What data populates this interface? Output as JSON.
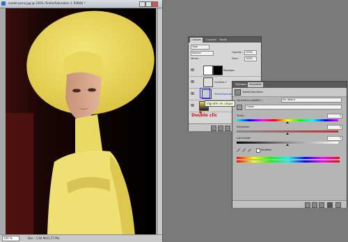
{
  "document": {
    "title": "model-yarno.jpg @ 100% (Teinte/Saturation 1, RVB/8) *",
    "zoom": "100 %",
    "info": "Doc : 1,94 Mo/1,77 Mo"
  },
  "layers_panel": {
    "tabs": [
      "Calques",
      "Couches",
      "Tracés"
    ],
    "kind_filter": "Type",
    "blend_mode": "Normal",
    "opacity_label": "Opacité :",
    "opacity_value": "100%",
    "lock_label": "Verrou :",
    "fill_label": "Fond :",
    "fill_value": "100%",
    "layers": [
      {
        "name": "Réglages",
        "type": "group"
      },
      {
        "name": "Courbes 1",
        "type": "adjustment"
      },
      {
        "name": "Teinte/Saturation",
        "type": "adjustment"
      },
      {
        "name": "Arrière-plan",
        "type": "pixel"
      }
    ],
    "tooltip": "Vignette de calque"
  },
  "properties_panel": {
    "tabs": [
      "Réglages",
      "Propriétés"
    ],
    "header_title": "Teinte/Saturation",
    "preset_label": "Paramètre prédéfini :",
    "preset_value": "Par défaut",
    "channel_value": "Global",
    "hue_label": "Teinte :",
    "hue_value": "0",
    "saturation_label": "Saturation :",
    "saturation_value": "0",
    "lightness_label": "Luminosité :",
    "lightness_value": "0",
    "colorize_label": "Redéfinir",
    "colorize_checked": false
  },
  "annotation": {
    "text": "Double clic",
    "color": "#c4151a"
  },
  "colors": {
    "workspace": "#7a7a7a",
    "hat_yellow": "#f2e36a",
    "highlight_blue": "#2b2bff"
  }
}
